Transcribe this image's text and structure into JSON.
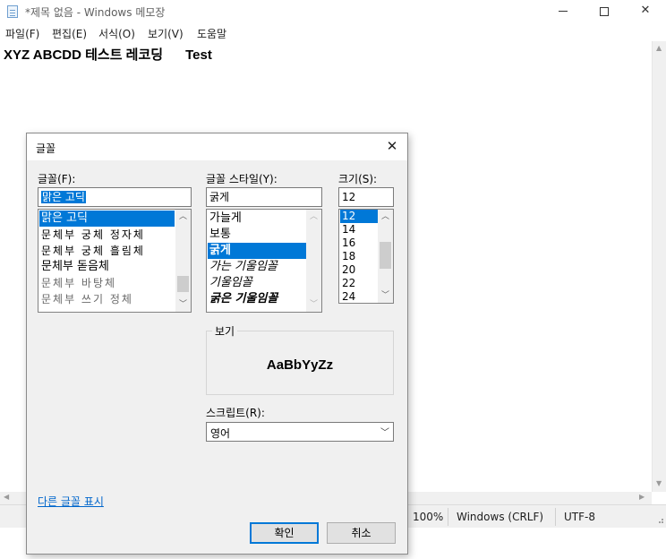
{
  "window": {
    "title": "*제목 없음 - Windows 메모장",
    "controls": {
      "minimize": "—",
      "maximize": "",
      "close": "✕"
    }
  },
  "menu": [
    "파일(F)",
    "편집(E)",
    "서식(O)",
    "보기(V)",
    "도움말"
  ],
  "editor": {
    "content": "XYZ ABCDD 테스트 레코딩      Test"
  },
  "statusbar": {
    "zoom": "100%",
    "line_ending": "Windows (CRLF)",
    "encoding": "UTF-8"
  },
  "font_dialog": {
    "title": "글꼴",
    "close": "✕",
    "font": {
      "label": "글꼴(F):",
      "value": "맑은 고딕",
      "items": [
        "맑은 고딕",
        "문체부 궁체 정자체",
        "문체부 궁체 흘림체",
        "문체부 돋음체",
        "문체부 바탕체",
        "문체부 쓰기 정체"
      ],
      "selected": "맑은 고딕"
    },
    "style": {
      "label": "글꼴 스타일(Y):",
      "value": "굵게",
      "items": [
        "가늘게",
        "보통",
        "굵게",
        "가는 기울임꼴",
        "기울임꼴",
        "굵은 기울임꼴"
      ],
      "selected": "굵게"
    },
    "size": {
      "label": "크기(S):",
      "value": "12",
      "items": [
        "12",
        "14",
        "16",
        "18",
        "20",
        "22",
        "24"
      ],
      "selected": "12"
    },
    "preview": {
      "label": "보기",
      "sample": "AaBbYyZz"
    },
    "script": {
      "label": "스크립트(R):",
      "value": "영어"
    },
    "more_fonts_link": "다른 글꼴 표시",
    "ok_button": "확인",
    "cancel_button": "취소"
  }
}
